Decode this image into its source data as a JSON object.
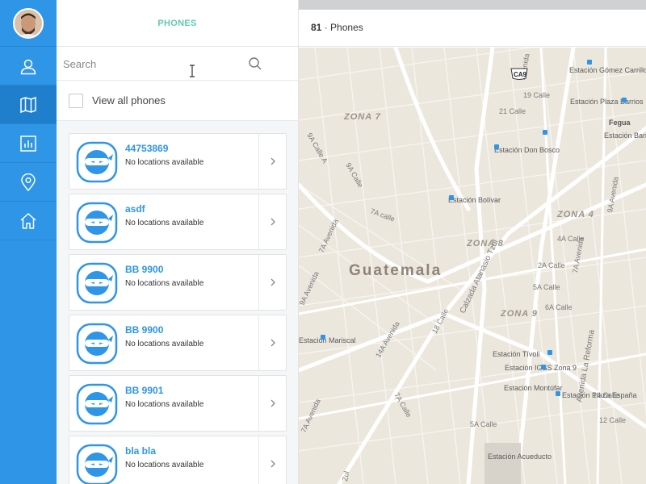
{
  "rail": {
    "items": [
      {
        "name": "user-icon"
      },
      {
        "name": "map-icon"
      },
      {
        "name": "chart-icon"
      },
      {
        "name": "location-pin-icon"
      },
      {
        "name": "home-icon"
      }
    ],
    "active_index": 1
  },
  "panel": {
    "title": "PHONES",
    "search_placeholder": "Search",
    "view_all_label": "View all phones",
    "phones": [
      {
        "name": "44753869",
        "status": "No locations available"
      },
      {
        "name": "asdf",
        "status": "No locations available"
      },
      {
        "name": "BB 9900",
        "status": "No locations available"
      },
      {
        "name": "BB 9900",
        "status": "No locations available"
      },
      {
        "name": "BB 9901",
        "status": "No locations available"
      },
      {
        "name": "bla bla",
        "status": "No locations available"
      }
    ]
  },
  "map_header": {
    "count": "81",
    "separator": "·",
    "label": "Phones"
  },
  "map": {
    "city": "Guatemala",
    "zones": [
      "ZONA 7",
      "ZONA 8",
      "ZONA 4",
      "ZONA 9"
    ],
    "streets": [
      "9A Avenida",
      "7A Avenida",
      "9A Calle A",
      "9A Calle",
      "7A calle",
      "2A Calle",
      "5A Calle",
      "6A Calle",
      "4A Calle",
      "12 Calle",
      "14 Calle",
      "5A Calle",
      "14A Avenida",
      "7A Avenida",
      "7A Calle",
      "19 Calle",
      "21 Calle",
      "18 Calle",
      "Calzada Atanasio Tzul",
      "Avenida La Reforma",
      "7A Avenida",
      "9A Avenida",
      "Avenida",
      "Zul",
      "CA9",
      "Fegua"
    ],
    "stations": [
      "Estación Gómez Carrillo",
      "Estación Plaza Barrios",
      "Estación Don Bosco",
      "Estación Banco de Guatemala",
      "Estación Bolívar",
      "Estación Tívoli",
      "Estación IGSS Zona 9",
      "Estación Montúfar",
      "Estación Plaza España",
      "Estación Acueducto",
      "Estación Mariscal"
    ],
    "colors": {
      "land": "#ece7dd",
      "road": "#ffffff",
      "label": "#7a7a7a",
      "zone": "#9a9489",
      "city": "#8e8577",
      "transit": "#2f95e6"
    }
  }
}
